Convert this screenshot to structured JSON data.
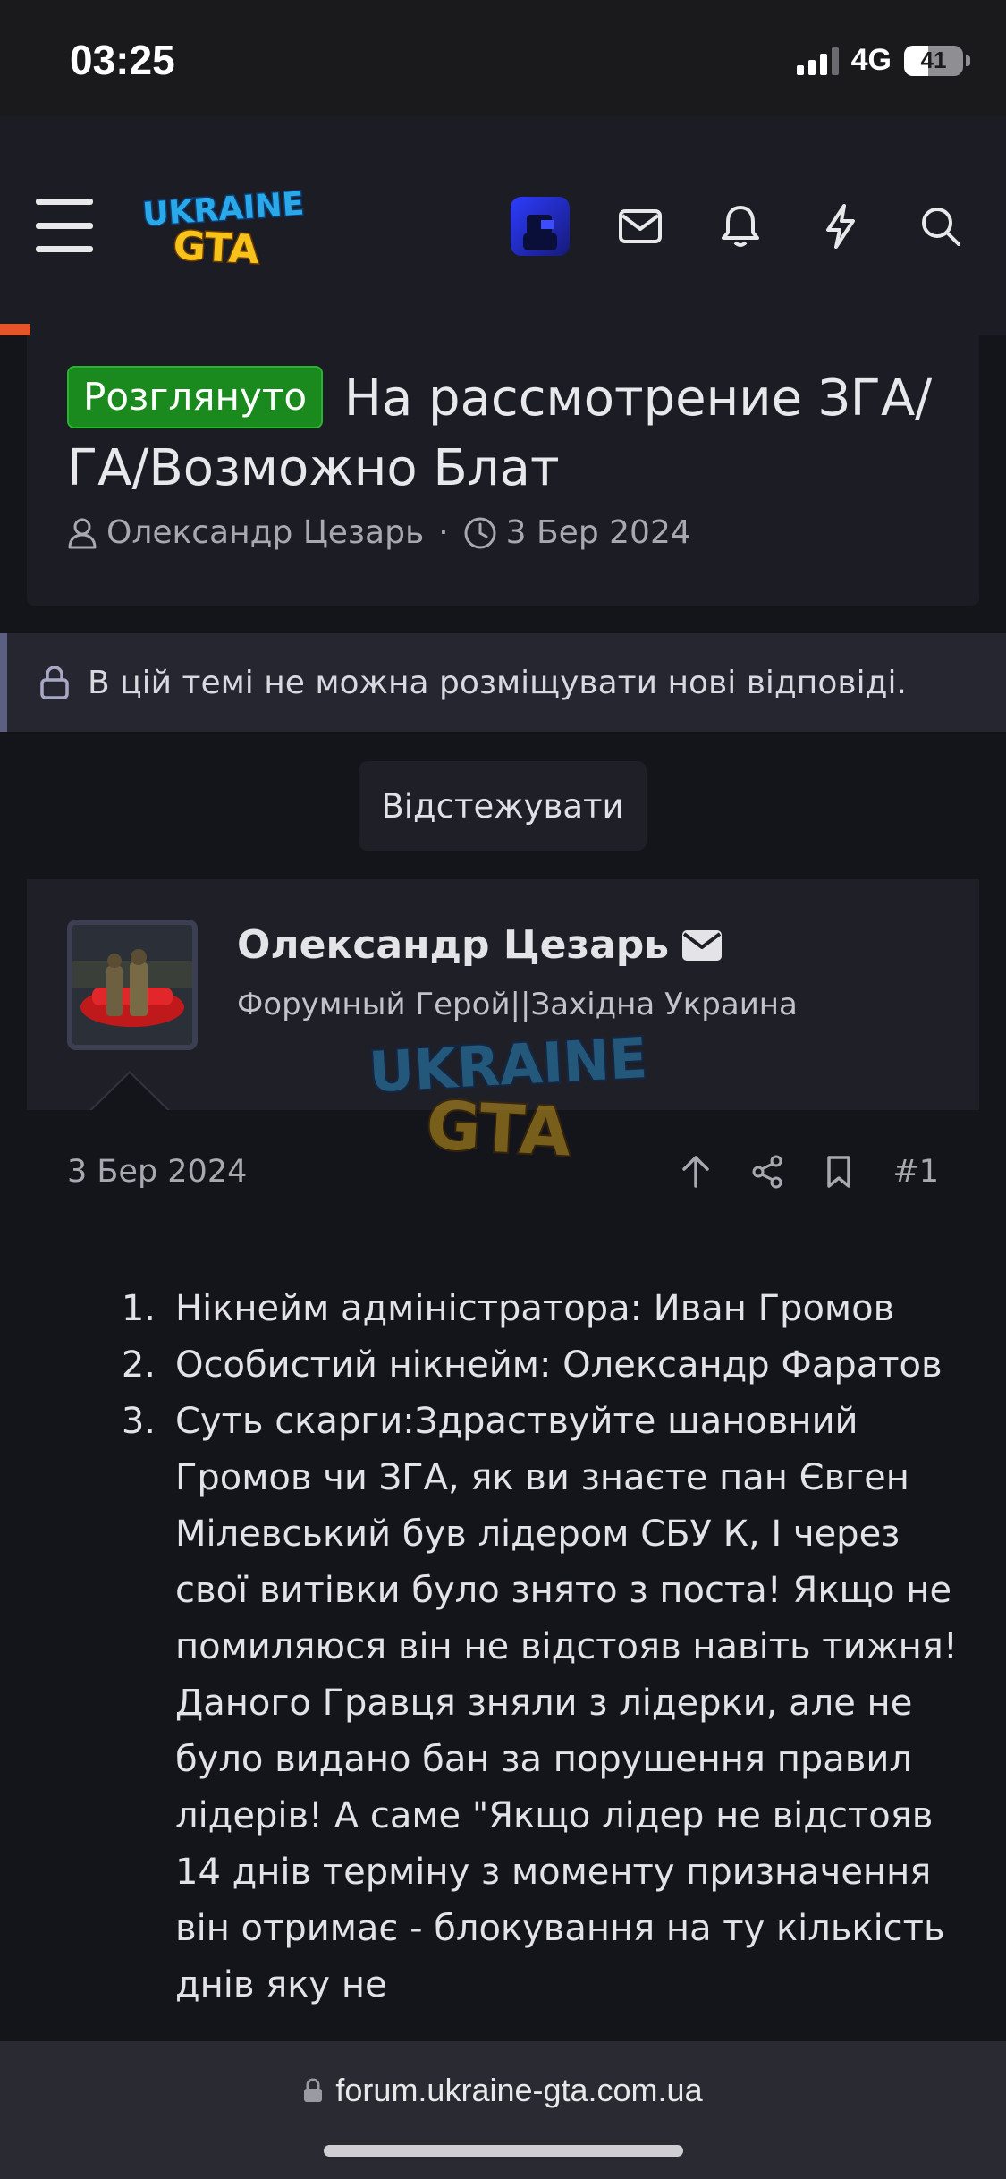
{
  "status_bar": {
    "time": "03:25",
    "network": "4G",
    "battery": "41",
    "battery_level": 0.41
  },
  "header": {
    "logo_alt": "UKRAINE GTA",
    "icons": [
      "menu-icon",
      "user-avatar-icon",
      "mail-icon",
      "bell-icon",
      "bolt-icon",
      "search-icon"
    ]
  },
  "thread": {
    "prefix": "Розглянуто",
    "title": "На рассмотрение ЗГА/ГА/Возможно Блат",
    "author": "Олександр Цезарь",
    "separator": "·",
    "date": "3 Бер 2024"
  },
  "notice": {
    "text": "В цій темі не можна розміщувати нові відповіді."
  },
  "watch_button": {
    "label": "Відстежувати"
  },
  "post": {
    "username": "Олександр Цезарь",
    "user_title": "Форумный Герой||Західна Украина",
    "date": "3 Бер 2024",
    "number": "#1",
    "items": [
      {
        "num": "1.",
        "text": "Нікнейм адміністратора: Иван Громов"
      },
      {
        "num": "2.",
        "text": "Особистий нікнейм: Олександр Фаратов"
      },
      {
        "num": "3.",
        "text": "Суть скарги:Здраствуйте шановний Громов чи ЗГА, як ви знаєте пан Євген Мілевський був лідером СБУ К, І через свої витівки було знято з поста! Якщо не помиляюся він не відстояв навіть тижня! Даного Гравця зняли з лідерки, але не було видано бан за порушення правил лідерів! А саме \"Якщо лідер не відстояв 14 днів терміну з моменту призначення він отримає - блокування на ту кількість днів яку не"
      }
    ]
  },
  "url_bar": {
    "url": "forum.ukraine-gta.com.ua"
  },
  "colors": {
    "background": "#14151b",
    "card": "#1c1d24",
    "prefix_green": "#1a8a1f",
    "accent_orange": "#e8542a"
  }
}
